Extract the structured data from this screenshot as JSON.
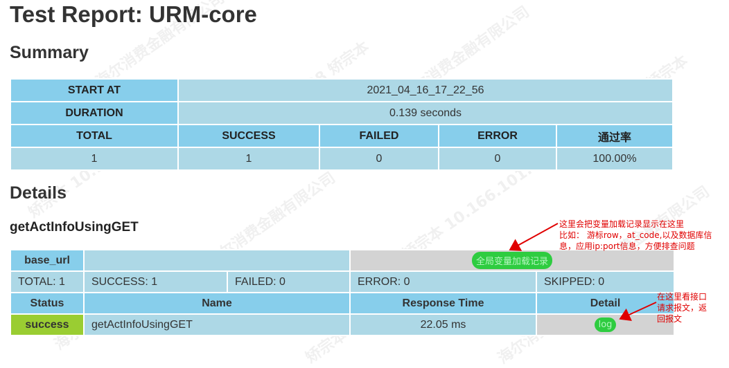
{
  "title": "Test Report: URM-core",
  "summary_heading": "Summary",
  "summary": {
    "start_at_label": "START AT",
    "start_at_value": "2021_04_16_17_22_56",
    "duration_label": "DURATION",
    "duration_value": "0.139 seconds",
    "headers": [
      "TOTAL",
      "SUCCESS",
      "FAILED",
      "ERROR",
      "通过率"
    ],
    "values": [
      "1",
      "1",
      "0",
      "0",
      "100.00%"
    ]
  },
  "details_heading": "Details",
  "testcase_name": "getActInfoUsingGET",
  "details": {
    "base_url_label": "base_url",
    "base_url_value": "",
    "global_vars_button": "全局变量加载记录",
    "stats": {
      "total": "TOTAL: 1",
      "success": "SUCCESS: 1",
      "failed": "FAILED: 0",
      "error": "ERROR: 0",
      "skipped": "SKIPPED: 0"
    },
    "columns": [
      "Status",
      "Name",
      "Response Time",
      "Detail"
    ],
    "rows": [
      {
        "status": "success",
        "name": "getActInfoUsingGET",
        "response_time": "22.05 ms",
        "detail": "log"
      }
    ]
  },
  "annotations": {
    "note1": [
      "这里会把变量加载记录显示在这里",
      "比如： 游标row，at_code,以及数据库信",
      "息，应用ip:port信息，方便排查问题"
    ],
    "note2": [
      "在这里看接口",
      "请求报文，返",
      "回报文"
    ]
  },
  "colors": {
    "header_bg": "#87ceeb",
    "cell_bg": "#add8e6",
    "success_bg": "#9acd32",
    "pill_bg": "#2ecc40",
    "annotation": "#e00000"
  }
}
